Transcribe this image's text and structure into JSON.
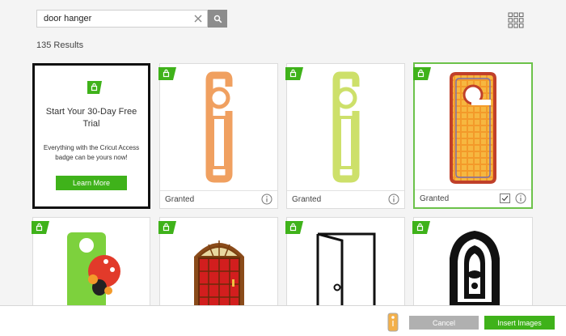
{
  "search": {
    "value": "door hanger",
    "placeholder": ""
  },
  "results_text": "135 Results",
  "colors": {
    "accent": "#3fb21a",
    "selected_border": "#6cc24a",
    "button_gray": "#b0b0b0"
  },
  "promo": {
    "title": "Start Your 30-Day Free Trial",
    "body": "Everything with the Cricut Access badge can be yours now!",
    "button": "Learn More"
  },
  "cards": [
    {
      "status": "Granted",
      "icon": "orange-door-hanger"
    },
    {
      "status": "Granted",
      "icon": "lime-door-hanger"
    },
    {
      "status": "Granted",
      "icon": "patterned-door-hanger",
      "selected": true
    },
    {
      "status": "",
      "icon": "monster-door-hanger"
    },
    {
      "status": "",
      "icon": "red-door"
    },
    {
      "status": "",
      "icon": "open-door-outline"
    },
    {
      "status": "",
      "icon": "ornate-black-frame"
    }
  ],
  "bottom": {
    "cancel_label": "Cancel",
    "insert_label": "Insert Images"
  }
}
